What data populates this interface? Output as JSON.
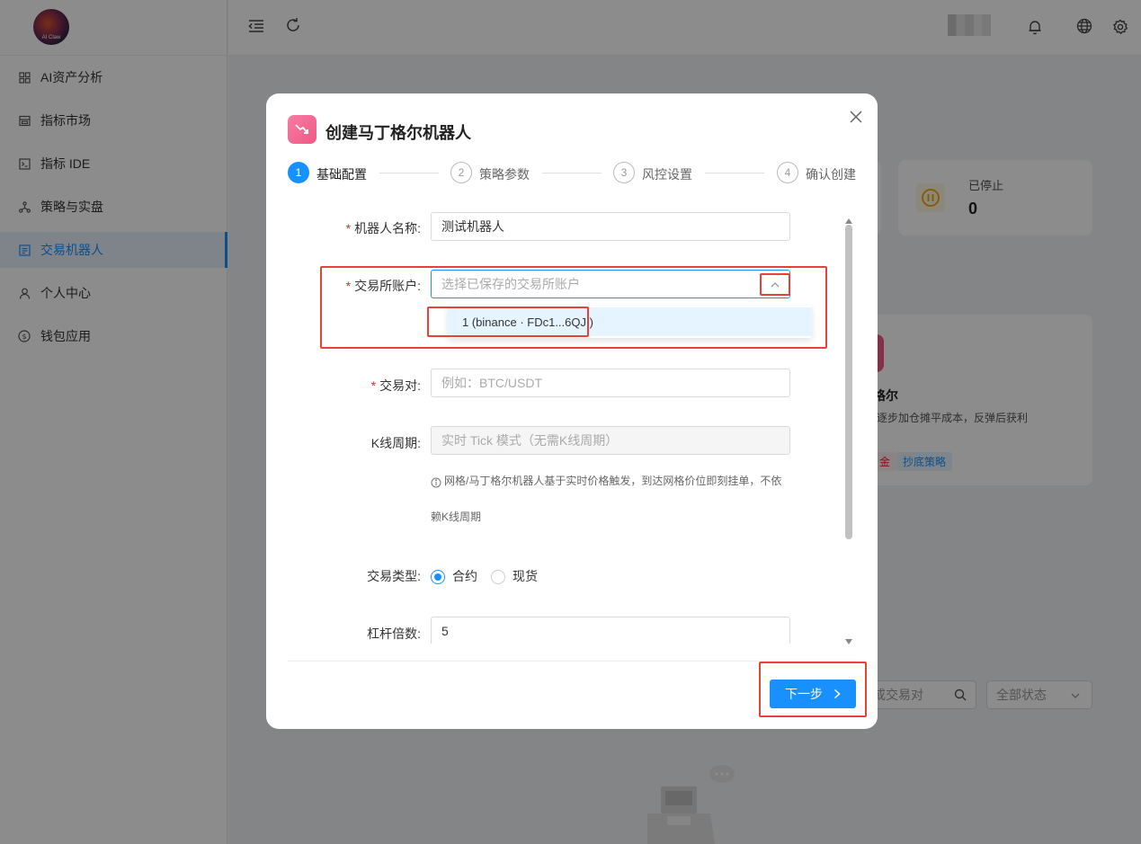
{
  "sidebar": {
    "logo_text": "AI Claw",
    "items": [
      {
        "label": "AI资产分析",
        "icon": "grid-icon"
      },
      {
        "label": "指标市场",
        "icon": "store-icon"
      },
      {
        "label": "指标 IDE",
        "icon": "terminal-icon"
      },
      {
        "label": "策略与实盘",
        "icon": "nodes-icon"
      },
      {
        "label": "交易机器人",
        "icon": "robot-icon",
        "active": true
      },
      {
        "label": "个人中心",
        "icon": "user-icon"
      },
      {
        "label": "钱包应用",
        "icon": "dollar-icon"
      }
    ]
  },
  "header": {
    "icons": [
      "collapse-icon",
      "refresh-icon",
      "bell-icon",
      "globe-icon",
      "gear-icon"
    ]
  },
  "background": {
    "stopped_label": "已停止",
    "stopped_value": "0",
    "card_title": "格尔",
    "card_desc": "逐步加仓摊平成本，反弹后获利",
    "tag_partial": "金",
    "tag_strategy": "抄底策略",
    "search_placeholder": "或交易对",
    "status_select": "全部状态"
  },
  "modal": {
    "title": "创建马丁格尔机器人",
    "steps": [
      {
        "num": "1",
        "label": "基础配置",
        "active": true
      },
      {
        "num": "2",
        "label": "策略参数"
      },
      {
        "num": "3",
        "label": "风控设置"
      },
      {
        "num": "4",
        "label": "确认创建"
      }
    ],
    "form": {
      "robot_name_label": "机器人名称:",
      "robot_name_value": "测试机器人",
      "account_label": "交易所账户:",
      "account_placeholder": "选择已保存的交易所账户",
      "account_option": "1 (binance · FDc1...6QJI)",
      "pair_label": "交易对:",
      "pair_placeholder": "例如：BTC/USDT",
      "kline_label": "K线周期:",
      "kline_value": "实时 Tick 模式（无需K线周期）",
      "hint_line1": "网格/马丁格尔机器人基于实时价格触发，到达网格价位即刻挂单，不依",
      "hint_line2": "赖K线周期",
      "trade_type_label": "交易类型:",
      "trade_type_options": [
        "合约",
        "现货"
      ],
      "trade_type_selected": "合约",
      "leverage_label": "杠杆倍数:",
      "leverage_value": "5"
    },
    "next_button": "下一步"
  },
  "colors": {
    "primary": "#1890ff",
    "highlight": "#e8413a",
    "required": "#f5222d"
  }
}
